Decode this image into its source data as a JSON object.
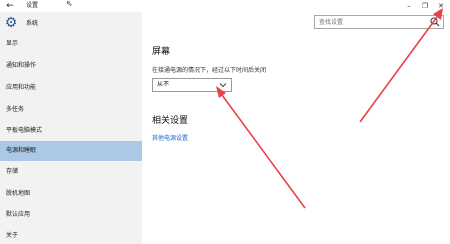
{
  "window": {
    "title": "设置",
    "back_glyph": "←",
    "cursor_glyph": "⇖",
    "minimize_glyph": "–",
    "maximize_glyph": "❐",
    "close_glyph": "✕"
  },
  "sidebar": {
    "home_label": "系统",
    "items": [
      {
        "label": "显示"
      },
      {
        "label": "通知和操作"
      },
      {
        "label": "应用和功能"
      },
      {
        "label": "多任务"
      },
      {
        "label": "平板电脑模式"
      },
      {
        "label": "电源和睡眠",
        "active": true
      },
      {
        "label": "存储"
      },
      {
        "label": "脱机地图"
      },
      {
        "label": "默认应用"
      },
      {
        "label": "关于"
      }
    ]
  },
  "search": {
    "placeholder": "查找设置"
  },
  "main": {
    "section_title": "屏幕",
    "description": "在接通电源的情况下，经过以下时间后关闭",
    "dropdown_value": "从不",
    "related_title": "相关设置",
    "related_link": "其他电源设置"
  },
  "colors": {
    "accent": "#2b5797",
    "active_item": "#a9c9e6",
    "link": "#1a67c7",
    "annotation_arrow": "#e8424b"
  },
  "icons": {
    "home": "gear-icon",
    "search": "search-icon",
    "dropdown": "chevron-down-icon"
  }
}
